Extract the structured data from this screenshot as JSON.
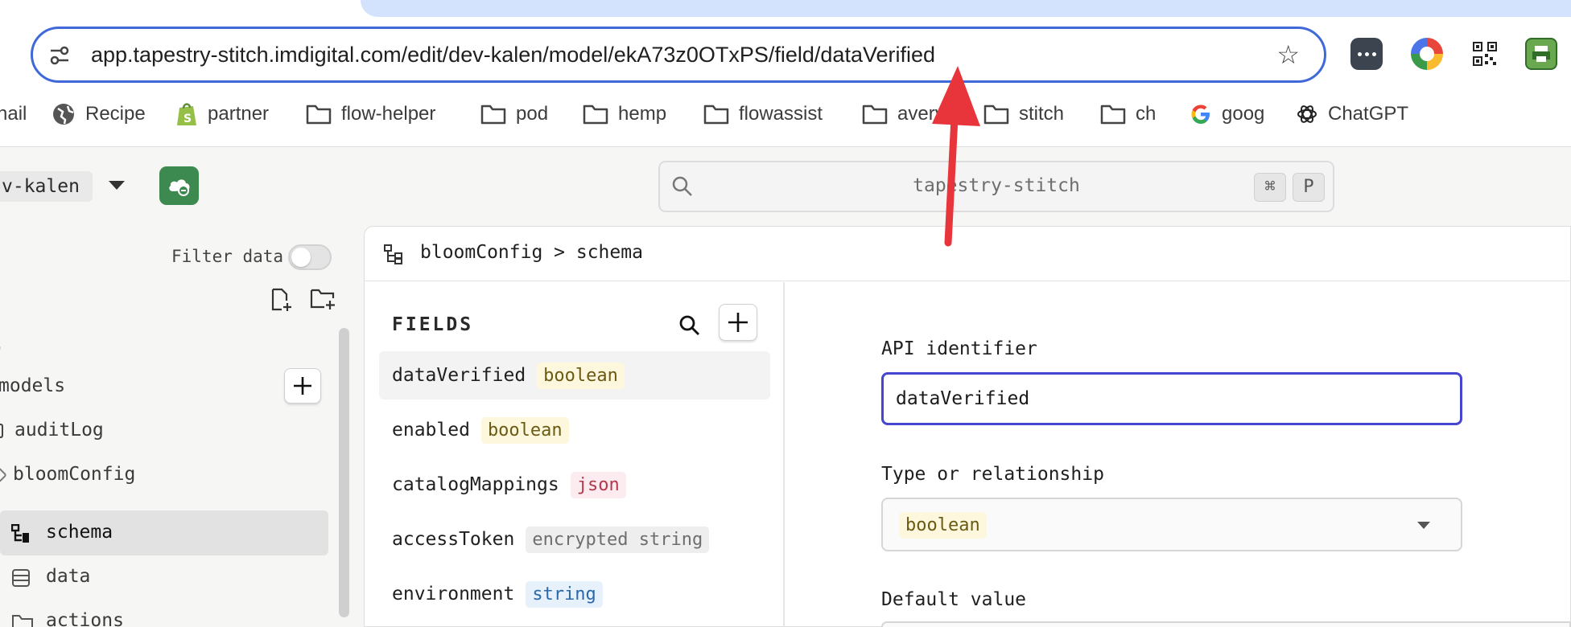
{
  "browser": {
    "url": "app.tapestry-stitch.imdigital.com/edit/dev-kalen/model/ekA73z0OTxPS/field/dataVerified",
    "bookmarks": [
      {
        "label": "nail",
        "icon": "mail-icon"
      },
      {
        "label": "Recipe",
        "icon": "globe-icon"
      },
      {
        "label": "partner",
        "icon": "shopify-icon"
      },
      {
        "label": "flow-helper",
        "icon": "folder-icon"
      },
      {
        "label": "pod",
        "icon": "folder-icon"
      },
      {
        "label": "hemp",
        "icon": "folder-icon"
      },
      {
        "label": "flowassist",
        "icon": "folder-icon"
      },
      {
        "label": "avery",
        "icon": "folder-icon"
      },
      {
        "label": "stitch",
        "icon": "folder-icon"
      },
      {
        "label": "ch",
        "icon": "folder-icon"
      },
      {
        "label": "goog",
        "icon": "google-icon"
      },
      {
        "label": "ChatGPT",
        "icon": "chatgpt-icon"
      }
    ],
    "extensions": [
      "password-manager-icon",
      "color-wheel-icon",
      "qr-code-icon",
      "printer-extension-icon"
    ]
  },
  "header": {
    "environment": "v-kalen",
    "search_placeholder": "tapestry-stitch",
    "shortcut_keys": [
      "⌘",
      "P"
    ]
  },
  "sidebar": {
    "filter_label": "Filter data",
    "filter_enabled": false,
    "section_label": "models",
    "items": [
      {
        "label": "auditLog"
      },
      {
        "label": "bloomConfig"
      },
      {
        "label": "schema"
      },
      {
        "label": "data"
      },
      {
        "label": "actions"
      }
    ]
  },
  "breadcrumb": {
    "text": "bloomConfig > schema"
  },
  "fields_panel": {
    "title": "FIELDS",
    "fields": [
      {
        "name": "dataVerified",
        "type": "boolean"
      },
      {
        "name": "enabled",
        "type": "boolean"
      },
      {
        "name": "catalogMappings",
        "type": "json"
      },
      {
        "name": "accessToken",
        "type": "encrypted string"
      },
      {
        "name": "environment",
        "type": "string"
      }
    ]
  },
  "form": {
    "api_label": "API identifier",
    "api_value": "dataVerified",
    "type_label": "Type or relationship",
    "type_value": "boolean",
    "default_label": "Default value"
  },
  "colors": {
    "accent": "#4545cf",
    "app_green": "#3c8a4f",
    "annotation_red": "#e8353b"
  }
}
